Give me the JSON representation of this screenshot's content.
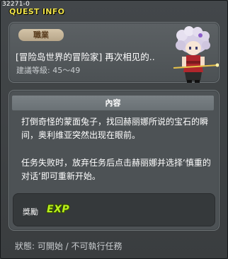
{
  "quest_id": "32271-0",
  "window_title": "QUEST INFO",
  "header": {
    "job_badge": "職業",
    "quest_name": "[冒险岛世界的冒险家] 再次相见的..",
    "level_requirement": "建議等級: 45～49"
  },
  "content": {
    "header_label": "內容",
    "paragraphs": [
      "打倒奇怪的蒙面兔子，找回赫丽娜所说的宝石的瞬间，奥利维亚突然出现在眼前。",
      "任务失败时，放弃任务后点击赫丽娜并选择‘慎重的对话’即可重新开始。"
    ],
    "reward_label": "獎勵",
    "reward_exp": "EXP"
  },
  "status_line": "狀態: 可開始 / 不可執行任務",
  "colors": {
    "title": "#f1e44a",
    "exp": "#b9f01c",
    "panel_bg": "#4d5255",
    "window_bg": "#3c3e3f"
  }
}
